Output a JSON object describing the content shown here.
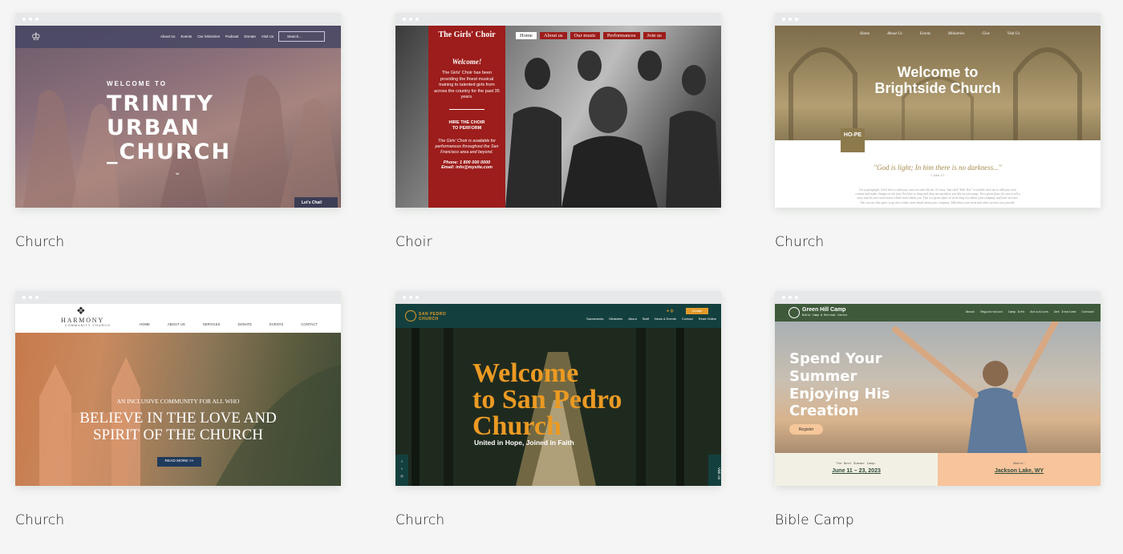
{
  "cards": [
    {
      "label": "Church",
      "site": {
        "nav_links": [
          "About Us",
          "Events",
          "Our Ministries",
          "Podcast",
          "Donate",
          "Visit Us"
        ],
        "search_placeholder": "Search...",
        "welcome": "WELCOME TO",
        "title_lines": [
          "TRINITY",
          "URBAN",
          "_CHURCH"
        ],
        "chat_label": "Let's Chat!"
      }
    },
    {
      "label": "Choir",
      "site": {
        "title": "The Girls' Choir",
        "nav_links": [
          "Home",
          "About us",
          "Our music",
          "Performances",
          "Join us"
        ],
        "welcome": "Welcome!",
        "body": "The Girls' Choir has been providing the finest musical training to talented girls from across the country for the past 35 years.",
        "hire_lines": [
          "HIRE THE CHOIR",
          "TO PERFORM"
        ],
        "availability": "The Girls' Choir is available for performances throughout the San Francisco area and beyond.",
        "phone": "Phone:  1 800 000 0000",
        "email": "Email:  info@mysite.com"
      }
    },
    {
      "label": "Church",
      "site": {
        "nav_links": [
          "Home",
          "About Us",
          "Events",
          "Ministries",
          "Give",
          "Visit Us"
        ],
        "title_lines": [
          "Welcome to",
          "Brightside Church"
        ],
        "badge": "HO-PE",
        "quote": "\"God is light; In him there is no darkness...\"",
        "citation": "1 John 1:5",
        "paragraph": "I'm a paragraph. Click here to add your own text and edit me. It's easy. Just click \"Edit Text\" or double click me to add your own content and make changes to the font. Feel free to drag and drop me anywhere you like on your page. I'm a great place for you to tell a story and let your users know a little more about you. This is a great space to write long text about your company and your services. You can use this space to go into a little more detail about your company. Talk about your team and what services you provide."
      }
    },
    {
      "label": "Church",
      "site": {
        "logo_title": "HARMONY",
        "logo_sub": "COMMUNITY CHURCH",
        "nav_links": [
          "HOME",
          "ABOUT US",
          "SERVICES",
          "DONATE",
          "EVENTS",
          "CONTACT"
        ],
        "intro": "AN INCLUSIVE COMMUNITY FOR ALL WHO",
        "title_lines": [
          "BELIEVE IN THE LOVE AND",
          "SPIRIT OF THE CHURCH"
        ],
        "cta": "READ MORE >>"
      }
    },
    {
      "label": "Church",
      "site": {
        "logo_lines": [
          "SAN PEDRO",
          "CHURCH"
        ],
        "nav_links": [
          "Sacraments",
          "Ministries",
          "About",
          "Staff",
          "News & Events",
          "Contact",
          "Read Online"
        ],
        "donate": "Donate",
        "title_lines": [
          "Welcome",
          "to San Pedro",
          "Church"
        ],
        "tagline": "United in Hope, Joined in Faith",
        "visit": "Visit Us"
      }
    },
    {
      "label": "Bible Camp",
      "site": {
        "logo_name": "Green Hill Camp",
        "logo_sub": "Bible Camp & Retreat Center",
        "nav_links": [
          "About",
          "Registration",
          "Camp Info",
          "Activities",
          "Get Involved",
          "Contact"
        ],
        "title_lines": [
          "Spend Your",
          "Summer",
          "Enjoying His",
          "Creation"
        ],
        "cta": "Register",
        "next_caption": "The Next Summer Camp:",
        "next_value": "June 11 – 23, 2023",
        "where_caption": "Where:",
        "where_value": "Jackson Lake, WY"
      }
    }
  ]
}
